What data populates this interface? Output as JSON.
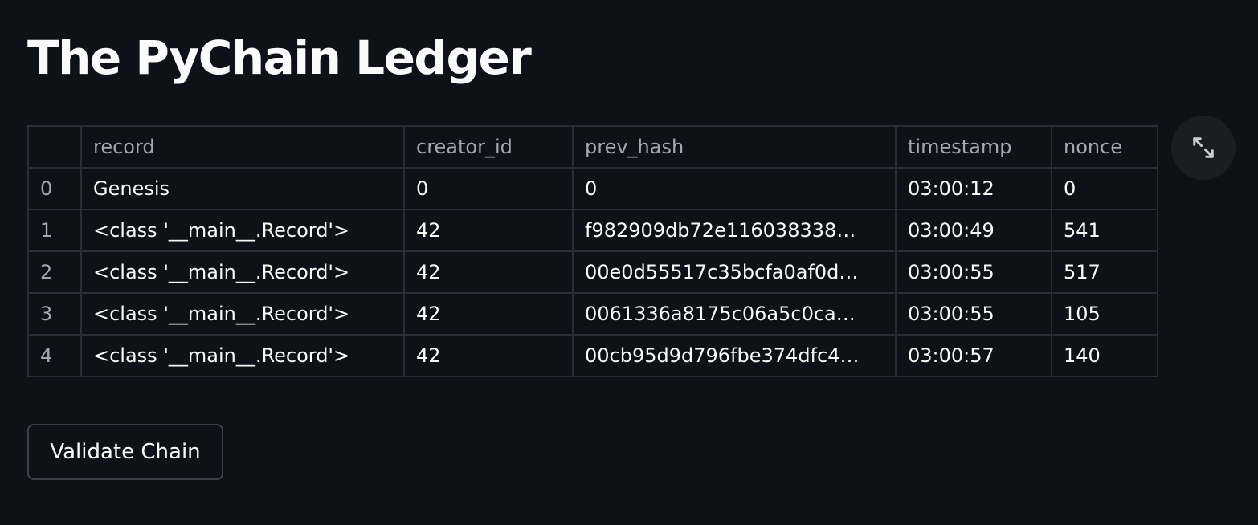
{
  "page": {
    "title": "The PyChain Ledger"
  },
  "table": {
    "columns": [
      "",
      "record",
      "creator_id",
      "prev_hash",
      "timestamp",
      "nonce"
    ],
    "rows": [
      {
        "index": "0",
        "record": "Genesis",
        "creator_id": "0",
        "prev_hash": "0",
        "timestamp": "03:00:12",
        "nonce": "0"
      },
      {
        "index": "1",
        "record": "<class '__main__.Record'>",
        "creator_id": "42",
        "prev_hash": "f982909db72e116038338…",
        "timestamp": "03:00:49",
        "nonce": "541"
      },
      {
        "index": "2",
        "record": "<class '__main__.Record'>",
        "creator_id": "42",
        "prev_hash": "00e0d55517c35bcfa0af0d…",
        "timestamp": "03:00:55",
        "nonce": "517"
      },
      {
        "index": "3",
        "record": "<class '__main__.Record'>",
        "creator_id": "42",
        "prev_hash": "0061336a8175c06a5c0ca…",
        "timestamp": "03:00:55",
        "nonce": "105"
      },
      {
        "index": "4",
        "record": "<class '__main__.Record'>",
        "creator_id": "42",
        "prev_hash": "00cb95d9d796fbe374dfc4…",
        "timestamp": "03:00:57",
        "nonce": "140"
      }
    ]
  },
  "expand": {
    "icon": "expand-icon"
  },
  "actions": {
    "validate_label": "Validate Chain"
  },
  "colors": {
    "background": "#0e1117",
    "text": "#fafafa",
    "muted_text": "#a3a8b4",
    "grid": "#2a2d36"
  }
}
